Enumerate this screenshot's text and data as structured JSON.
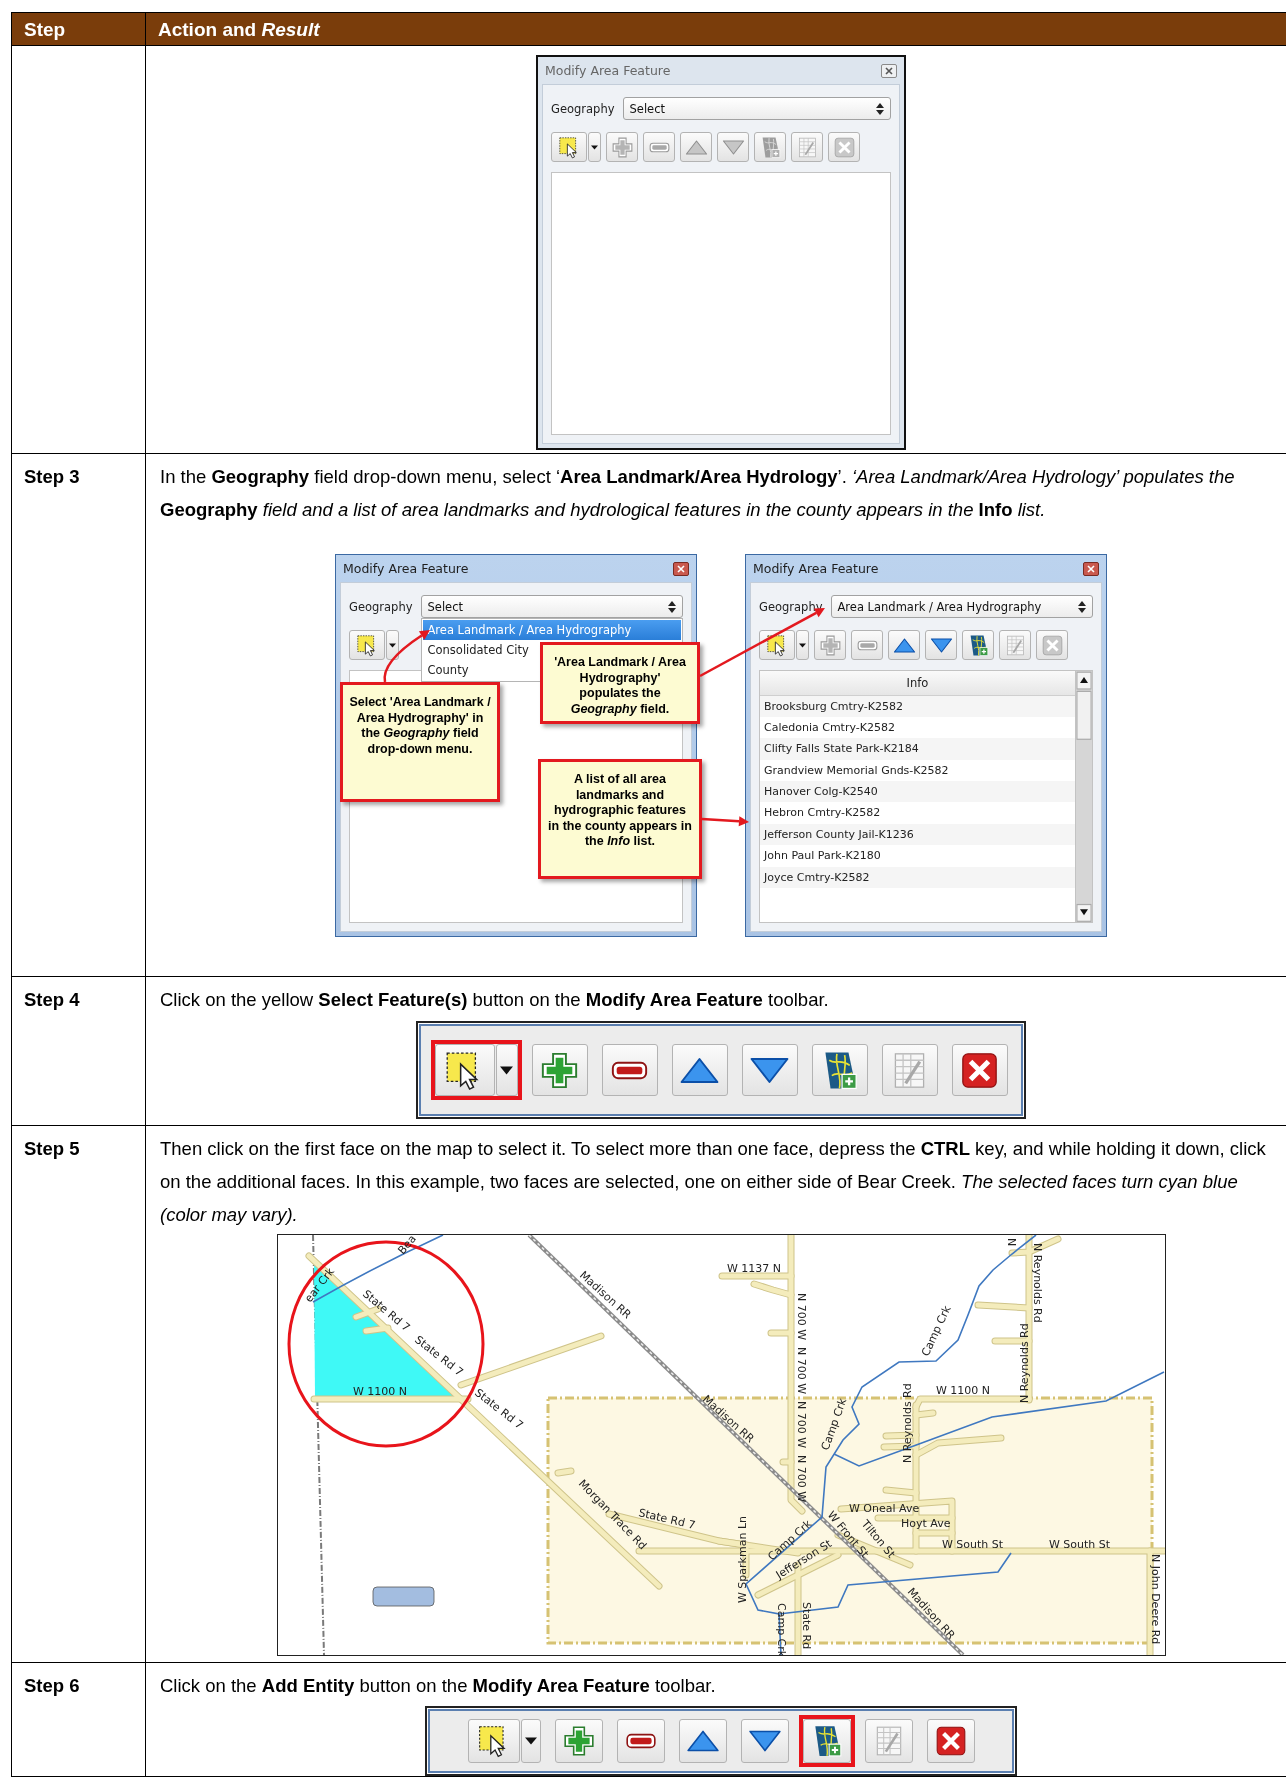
{
  "table": {
    "header": {
      "column_1": "Step",
      "column_2": "Action and *Result*"
    },
    "rows": [
      {
        "figure": {
          "kind": "dialog",
          "dialog": {
            "title": "Modify Area Feature",
            "active": false,
            "geography_label": "Geography",
            "geography_value": "Select",
            "toolbar": [
              {
                "kind": "select",
                "disabled": false
              },
              {
                "kind": "add",
                "disabled": true
              },
              {
                "kind": "remove",
                "disabled": true
              },
              {
                "kind": "up",
                "disabled": true
              },
              {
                "kind": "down",
                "disabled": true
              },
              {
                "kind": "map",
                "disabled": true
              },
              {
                "kind": "table",
                "disabled": true
              },
              {
                "kind": "close",
                "disabled": true
              }
            ]
          }
        }
      },
      {
        "step": "Step 3",
        "text": "In the **Geography** field drop-down menu, select ‘**Area Landmark/Area Hydrology**’. *‘Area Landmark/Area Hydrology’ populates the* **Geography** *field and a list of area landmarks and hydrological features in the county appears in the* **Info** *list.*",
        "figure": {
          "kind": "dialog_pair",
          "dialogs": [
            {
              "title": "Modify Area Feature",
              "active": true,
              "geography_label": "Geography",
              "geography_value": "Select",
              "dropdown": {
                "options": [
                  {
                    "label": "Area Landmark / Area Hydrography",
                    "selected": true
                  },
                  {
                    "label": "Consolidated City",
                    "selected": false
                  },
                  {
                    "label": "County",
                    "selected": false
                  }
                ]
              },
              "toolbar": [
                {
                  "kind": "select",
                  "disabled": false
                }
              ]
            },
            {
              "title": "Modify Area Feature",
              "active": true,
              "geography_label": "Geography",
              "geography_value": "Area Landmark / Area Hydrography",
              "toolbar": [
                {
                  "kind": "select",
                  "disabled": false
                },
                {
                  "kind": "add",
                  "disabled": true
                },
                {
                  "kind": "remove",
                  "disabled": true
                },
                {
                  "kind": "up",
                  "disabled": false
                },
                {
                  "kind": "down",
                  "disabled": false
                },
                {
                  "kind": "map",
                  "disabled": false
                },
                {
                  "kind": "table",
                  "disabled": true
                },
                {
                  "kind": "close",
                  "disabled": true
                }
              ],
              "info_list": {
                "header": "Info",
                "items": [
                  "Brooksburg Cmtry-K2582",
                  "Caledonia Cmtry-K2582",
                  "Clifty Falls State Park-K2184",
                  "Grandview Memorial Gnds-K2582",
                  "Hanover Colg-K2540",
                  "Hebron Cmtry-K2582",
                  "Jefferson County Jail-K1236",
                  "John Paul Park-K2180",
                  "Joyce Cmtry-K2582"
                ]
              }
            }
          ],
          "callouts": [
            {
              "text": "Select 'Area Landmark / Area Hydrography' in the *Geography* field drop-down menu."
            },
            {
              "text": "'Area Landmark / Area Hydrography' populates the *Geography* field."
            },
            {
              "text": "A list of all area landmarks and hydrographic features in the county appears in the *Info* list."
            }
          ]
        }
      },
      {
        "step": "Step 4",
        "text": "Click on the yellow **Select Feature(s)** button on the **Modify Area Feature** toolbar.",
        "figure": {
          "kind": "toolbar",
          "buttons": [
            {
              "kind": "select",
              "disabled": false,
              "highlighted": true
            },
            {
              "kind": "add",
              "disabled": false,
              "highlighted": false
            },
            {
              "kind": "remove",
              "disabled": false,
              "highlighted": false
            },
            {
              "kind": "up",
              "disabled": false,
              "highlighted": false
            },
            {
              "kind": "down",
              "disabled": false,
              "highlighted": false
            },
            {
              "kind": "map",
              "disabled": false,
              "highlighted": false
            },
            {
              "kind": "table",
              "disabled": true,
              "highlighted": false
            },
            {
              "kind": "close",
              "disabled": false,
              "highlighted": false
            }
          ]
        }
      },
      {
        "step": "Step 5",
        "text": "Then click on the first face on the map to select it. To select more than one face, depress the **CTRL** key, and while holding it down, click on the additional faces. In this example, two faces are selected, one on either side of Bear Creek. *The selected faces turn cyan blue (color may vary).*",
        "figure": {
          "kind": "map",
          "labels": [
            "Bea",
            "ear Crk",
            "State Rd 7",
            "State Rd 7",
            "State Rd 7",
            "W 1100 N",
            "Madison RR",
            "Morgan Trace Rd",
            "State Rd 7",
            "Madison RR",
            "W 1137 N",
            "N 700 W",
            "N 700 W",
            "N 700 W",
            "N 700 W",
            "Camp Crk",
            "N",
            "N Reynolds Rd",
            "N Reynolds Rd",
            "W 1100 N",
            "Camp Crk",
            "N Reynolds Rd",
            "W Oneal Ave",
            "Hoyt Ave",
            "W South St",
            "W South St",
            "Camp Crk",
            "W Front St",
            "Tilton St",
            "Jefferson St",
            "W Sparkman Ln",
            "Camp Crk",
            "State Rd",
            "Madison RR",
            "N John Deere Rd"
          ]
        }
      },
      {
        "step": "Step 6",
        "text": "Click on the **Add Entity** button on the **Modify Area Feature** toolbar.",
        "figure": {
          "kind": "toolbar",
          "buttons": [
            {
              "kind": "select",
              "disabled": false,
              "highlighted": false
            },
            {
              "kind": "add",
              "disabled": false,
              "highlighted": false
            },
            {
              "kind": "remove",
              "disabled": false,
              "highlighted": false
            },
            {
              "kind": "up",
              "disabled": false,
              "highlighted": false
            },
            {
              "kind": "down",
              "disabled": false,
              "highlighted": false
            },
            {
              "kind": "map",
              "disabled": false,
              "highlighted": true
            },
            {
              "kind": "table",
              "disabled": true,
              "highlighted": false
            },
            {
              "kind": "close",
              "disabled": false,
              "highlighted": false
            }
          ]
        }
      }
    ]
  }
}
